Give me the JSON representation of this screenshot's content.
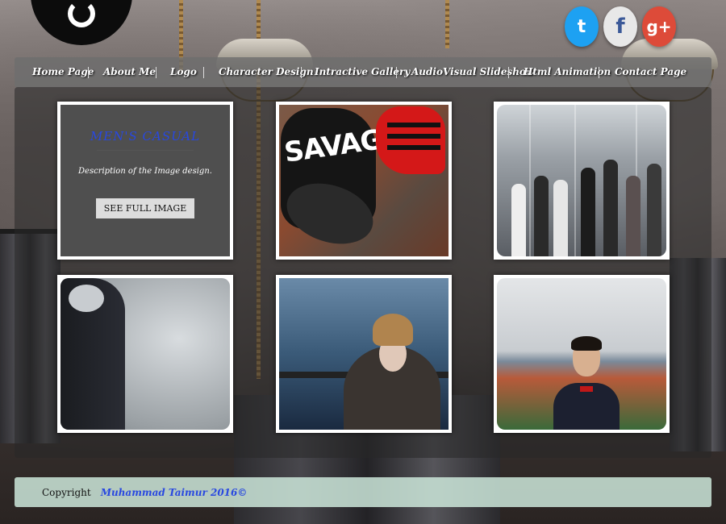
{
  "logo": {
    "icon": "logo-mark"
  },
  "social": [
    {
      "name": "twitter",
      "glyph": "t"
    },
    {
      "name": "facebook",
      "glyph": "f"
    },
    {
      "name": "google-plus",
      "glyph": "g+"
    }
  ],
  "nav": {
    "items": [
      {
        "label": "Home Page"
      },
      {
        "label": "About Me"
      },
      {
        "label": "Logo"
      },
      {
        "label": "Character Design"
      },
      {
        "label": "Intractive Gallery"
      },
      {
        "label": "AudioVisual Slideshow"
      },
      {
        "label": "Html Animation"
      },
      {
        "label": "Contact Page"
      }
    ]
  },
  "gallery": {
    "featured": {
      "title": "MEN'S CASUAL",
      "description": "Description of the Image design.",
      "button_label": "SEE FULL IMAGE"
    },
    "cap_text": "SAVAGE"
  },
  "footer": {
    "label": "Copyright",
    "author": "Muhammad Taimur 2016©"
  },
  "colors": {
    "accent": "#2848e0",
    "twitter": "#1da1f2",
    "google": "#dd4b39",
    "footer_bg": "#cde8da"
  }
}
